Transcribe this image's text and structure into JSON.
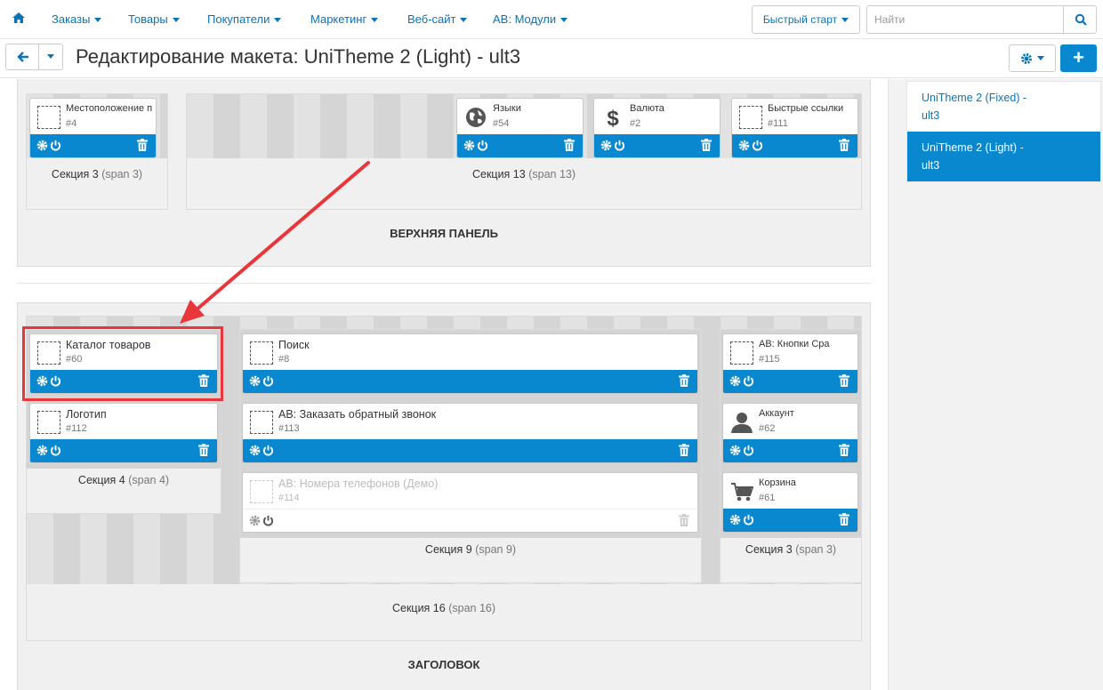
{
  "topnav": {
    "items": [
      "Заказы",
      "Товары",
      "Покупатели",
      "Маркетинг",
      "Веб-сайт",
      "АВ: Модули"
    ],
    "quick_start": "Быстрый старт",
    "search_placeholder": "Найти"
  },
  "header": {
    "title": "Редактирование макета: UniTheme 2 (Light) - ult3"
  },
  "sidebar": {
    "items": [
      {
        "line1": "UniTheme 2 (Fixed) -",
        "line2": "ult3",
        "active": false
      },
      {
        "line1": "UniTheme 2 (Light) -",
        "line2": "ult3",
        "active": true
      }
    ]
  },
  "colors": {
    "accent": "#0a88cf",
    "link": "#0a73b8",
    "highlight": "#e8363a"
  },
  "top_panel": {
    "name": "ВЕРХНЯЯ ПАНЕЛЬ",
    "sections": [
      {
        "label": "Секция 3",
        "span": "(span 3)",
        "blocks": [
          {
            "name": "Местоположение по",
            "id": "#4",
            "icon": "placeholder-icon"
          }
        ]
      },
      {
        "label": "Секция 13",
        "span": "(span 13)",
        "blocks": [
          {
            "name": "Языки",
            "id": "#54",
            "icon": "globe-icon"
          },
          {
            "name": "Валюта",
            "id": "#2",
            "icon": "dollar-icon"
          },
          {
            "name": "Быстрые ссылки",
            "id": "#111",
            "icon": "placeholder-icon"
          }
        ]
      }
    ]
  },
  "header_container": {
    "name": "ЗАГОЛОВОК",
    "outer_section": {
      "label": "Секция 16",
      "span": "(span 16)"
    },
    "sections": [
      {
        "label": "Секция 4",
        "span": "(span 4)",
        "blocks": [
          {
            "name": "Каталог товаров",
            "id": "#60",
            "icon": "placeholder-icon",
            "highlighted": true
          },
          {
            "name": "Логотип",
            "id": "#112",
            "icon": "placeholder-icon"
          }
        ]
      },
      {
        "label": "Секция 9",
        "span": "(span 9)",
        "blocks": [
          {
            "name": "Поиск",
            "id": "#8",
            "icon": "placeholder-icon"
          },
          {
            "name": "АВ: Заказать обратный звонок",
            "id": "#113",
            "icon": "placeholder-icon"
          },
          {
            "name": "АВ: Номера телефонов (Демо)",
            "id": "#114",
            "icon": "placeholder-icon",
            "disabled": true
          }
        ]
      },
      {
        "label": "Секция 3",
        "span": "(span 3)",
        "blocks": [
          {
            "name": "АВ: Кнопки Сра",
            "id": "#115",
            "icon": "placeholder-icon"
          },
          {
            "name": "Аккаунт",
            "id": "#62",
            "icon": "user-icon"
          },
          {
            "name": "Корзина",
            "id": "#61",
            "icon": "cart-icon"
          }
        ]
      }
    ]
  }
}
